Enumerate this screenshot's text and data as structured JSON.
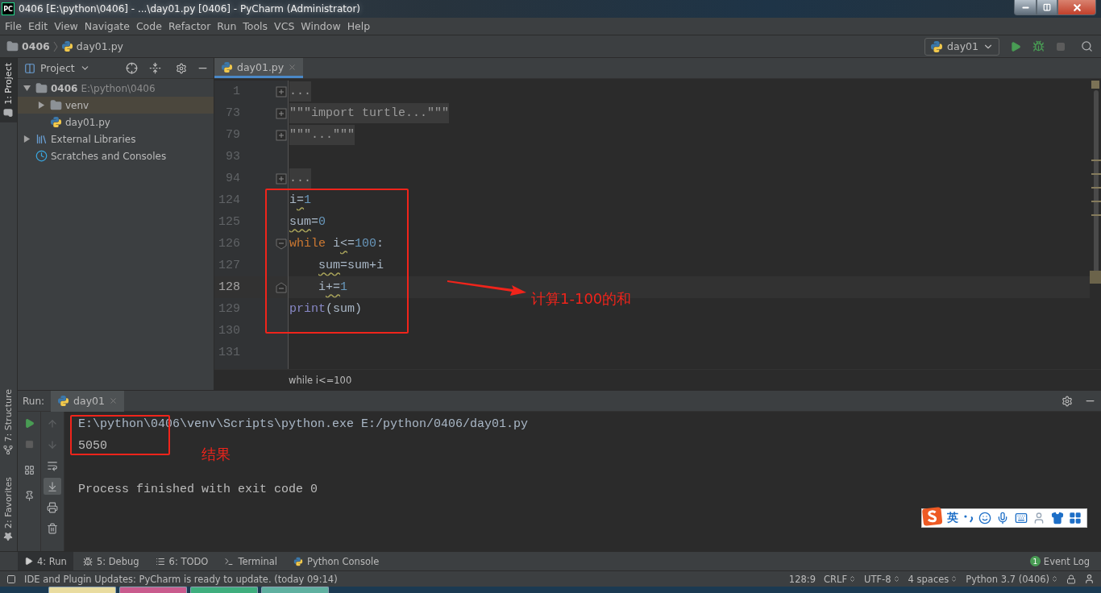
{
  "window": {
    "logo": "PC",
    "title": "0406 [E:\\python\\0406] - ...\\day01.py [0406] - PyCharm (Administrator)"
  },
  "menu": [
    "File",
    "Edit",
    "View",
    "Navigate",
    "Code",
    "Refactor",
    "Run",
    "Tools",
    "VCS",
    "Window",
    "Help"
  ],
  "navigation": {
    "breadcrumb": [
      {
        "kind": "folder",
        "label": "0406"
      },
      {
        "kind": "python",
        "label": "day01.py"
      }
    ],
    "run_config": "day01"
  },
  "left_stripe": {
    "top": [
      {
        "label": "1: Project",
        "kind": "project",
        "selected": true
      }
    ],
    "bottom": [
      {
        "label": "7: Structure",
        "kind": "structure",
        "selected": false
      },
      {
        "label": "2: Favorites",
        "kind": "favorites",
        "selected": false
      }
    ]
  },
  "project_panel": {
    "title": "Project",
    "tree": [
      {
        "label": "0406",
        "path": "E:\\python\\0406",
        "kind": "folder",
        "expanded": true,
        "selected": false,
        "children": [
          {
            "label": "venv",
            "kind": "venv",
            "expanded": false,
            "selected": true
          },
          {
            "label": "day01.py",
            "kind": "python",
            "selected": false
          }
        ]
      },
      {
        "label": "External Libraries",
        "kind": "library",
        "expanded": false,
        "selected": false
      },
      {
        "label": "Scratches and Consoles",
        "kind": "scratch",
        "selected": false
      }
    ]
  },
  "editor": {
    "tabs": [
      {
        "label": "day01.py",
        "selected": true
      }
    ],
    "lines": [
      {
        "number": "1",
        "collapsed": true,
        "fold_start": false,
        "fold_end": false,
        "current": false,
        "indented": false,
        "tokens": [
          {
            "kind": "folded",
            "text": "...",
            "warn": false
          }
        ]
      },
      {
        "number": "73",
        "collapsed": true,
        "fold_start": false,
        "fold_end": false,
        "current": false,
        "indented": false,
        "tokens": [
          {
            "kind": "folded",
            "text": "\"\"\"import turtle...\"\"\"",
            "warn": false
          }
        ]
      },
      {
        "number": "79",
        "collapsed": true,
        "fold_start": false,
        "fold_end": false,
        "current": false,
        "indented": false,
        "tokens": [
          {
            "kind": "folded",
            "text": "\"\"\"...\"\"\"",
            "warn": false
          }
        ]
      },
      {
        "number": "93",
        "collapsed": false,
        "fold_start": false,
        "fold_end": false,
        "current": false
      },
      {
        "number": "94",
        "collapsed": true,
        "fold_start": false,
        "fold_end": false,
        "current": false,
        "indented": false,
        "tokens": [
          {
            "kind": "folded",
            "text": "...",
            "warn": false
          }
        ]
      },
      {
        "number": "124",
        "collapsed": false,
        "fold_start": false,
        "fold_end": false,
        "current": false,
        "indented": false,
        "tokens": [
          {
            "kind": "plain",
            "text": "i",
            "warn": false
          },
          {
            "kind": "plain",
            "text": "=",
            "warn": true
          },
          {
            "kind": "number",
            "text": "1",
            "warn": false
          }
        ]
      },
      {
        "number": "125",
        "collapsed": false,
        "fold_start": false,
        "fold_end": false,
        "current": false,
        "indented": false,
        "tokens": [
          {
            "kind": "plain",
            "text": "sum",
            "warn": true
          },
          {
            "kind": "plain",
            "text": "=",
            "warn": false
          },
          {
            "kind": "number",
            "text": "0",
            "warn": false
          }
        ]
      },
      {
        "number": "126",
        "collapsed": false,
        "fold_start": true,
        "fold_end": false,
        "current": false,
        "indented": false,
        "tokens": [
          {
            "kind": "keyword",
            "text": "while",
            "warn": false
          },
          {
            "kind": "plain",
            "text": " i",
            "warn": false
          },
          {
            "kind": "plain",
            "text": "<",
            "warn": true
          },
          {
            "kind": "plain",
            "text": "=",
            "warn": false
          },
          {
            "kind": "number",
            "text": "100",
            "warn": false
          },
          {
            "kind": "plain",
            "text": ":",
            "warn": false
          }
        ]
      },
      {
        "number": "127",
        "collapsed": false,
        "fold_start": false,
        "fold_end": false,
        "current": false,
        "indented": true,
        "tokens": [
          {
            "kind": "plain",
            "text": "sum",
            "warn": true
          },
          {
            "kind": "plain",
            "text": "=sum+i",
            "warn": false
          }
        ]
      },
      {
        "number": "128",
        "collapsed": false,
        "fold_start": false,
        "fold_end": true,
        "current": true,
        "indented": true,
        "tokens": [
          {
            "kind": "plain",
            "text": "i",
            "warn": false
          },
          {
            "kind": "plain",
            "text": "+=",
            "warn": true
          },
          {
            "kind": "number",
            "text": "1",
            "warn": false
          }
        ]
      },
      {
        "number": "129",
        "collapsed": false,
        "fold_start": false,
        "fold_end": false,
        "current": false,
        "indented": false,
        "tokens": [
          {
            "kind": "builtin",
            "text": "print",
            "warn": false
          },
          {
            "kind": "plain",
            "text": "(sum)",
            "warn": false
          }
        ]
      },
      {
        "number": "130",
        "collapsed": false,
        "fold_start": false,
        "fold_end": false,
        "current": false
      },
      {
        "number": "131",
        "collapsed": false,
        "fold_start": false,
        "fold_end": false,
        "current": false
      }
    ],
    "breadcrumb": "while i<=100"
  },
  "annotations": {
    "code_note": "计算1-100的和",
    "result_note": "结果"
  },
  "run_panel": {
    "title": "Run:",
    "tabs": [
      {
        "label": "day01",
        "selected": true
      }
    ],
    "output": [
      {
        "kind": "command",
        "text": "E:\\python\\0406\\venv\\Scripts\\python.exe E:/python/0406/day01.py"
      },
      {
        "kind": "stdout",
        "text": "5050"
      },
      {
        "kind": "exit",
        "text": "Process finished with exit code 0"
      }
    ]
  },
  "ime_toolbar": {
    "mode": "英"
  },
  "tool_tabs": [
    {
      "label": "4: Run",
      "kind": "run",
      "selected": true
    },
    {
      "label": "5: Debug",
      "kind": "debug",
      "selected": false
    },
    {
      "label": "6: TODO",
      "kind": "todo",
      "selected": false
    },
    {
      "label": "Terminal",
      "kind": "terminal",
      "selected": false
    },
    {
      "label": "Python Console",
      "kind": "console",
      "selected": false
    }
  ],
  "event_log": {
    "count": "1",
    "label": "Event Log"
  },
  "status_bar": {
    "message": "IDE and Plugin Updates: PyCharm is ready to update. (today 09:14)",
    "items": [
      {
        "label": "128:9",
        "dropdown": false
      },
      {
        "label": "CRLF",
        "dropdown": true
      },
      {
        "label": "UTF-8",
        "dropdown": true
      },
      {
        "label": "4 spaces",
        "dropdown": true
      },
      {
        "label": "Python 3.7 (0406)",
        "dropdown": true
      }
    ]
  }
}
